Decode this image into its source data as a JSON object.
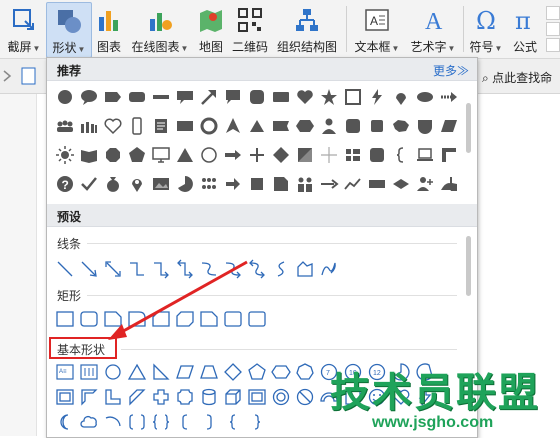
{
  "toolbar": {
    "screenshot": "截屏",
    "shapes": "形状",
    "chart": "图表",
    "online_chart": "在线图表",
    "map": "地图",
    "qrcode": "二维码",
    "orgchart": "组织结构图",
    "textbox": "文本框",
    "wordart": "艺术字",
    "symbol": "符号",
    "formula": "公式"
  },
  "subbar": {
    "find_command": "点此查找命"
  },
  "panel": {
    "recommended": "推荐",
    "more": "更多≫",
    "presets": "预设",
    "lines": "线条",
    "rectangles": "矩形",
    "basic_shapes": "基本形状"
  },
  "watermark": {
    "text": "技术员联盟",
    "url": "www.jsgho.com"
  },
  "colors": {
    "accent": "#2a6ec9",
    "highlight": "#e02424",
    "watermark": "#1fa35a"
  }
}
